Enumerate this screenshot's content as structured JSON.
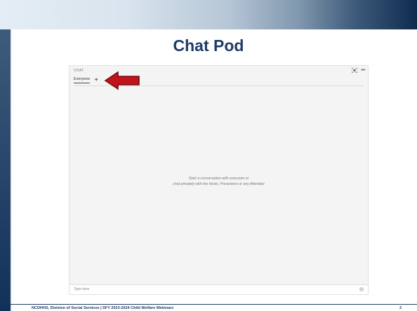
{
  "slide": {
    "title": "Chat Pod",
    "footer_text": "NCDHHS, Division of Social Services | SFY 2023-2024 Child Welfare Webinars",
    "page_number": "2"
  },
  "chat_pod": {
    "header_label": "CHAT",
    "tabs": [
      {
        "label": "Everyone",
        "selected": true
      }
    ],
    "add_tab_symbol": "+",
    "empty_message_line1": "Start a conversation with everyone or",
    "empty_message_line2": "chat privately with the Hosts, Presenters or any Attendee",
    "input_placeholder": "Type here",
    "icons": {
      "expand": "expand-icon",
      "more": "more-options-icon",
      "send": "send-icon"
    }
  },
  "annotation": {
    "arrow_color": "#c0141c",
    "arrow_outline": "#7a0a10"
  }
}
